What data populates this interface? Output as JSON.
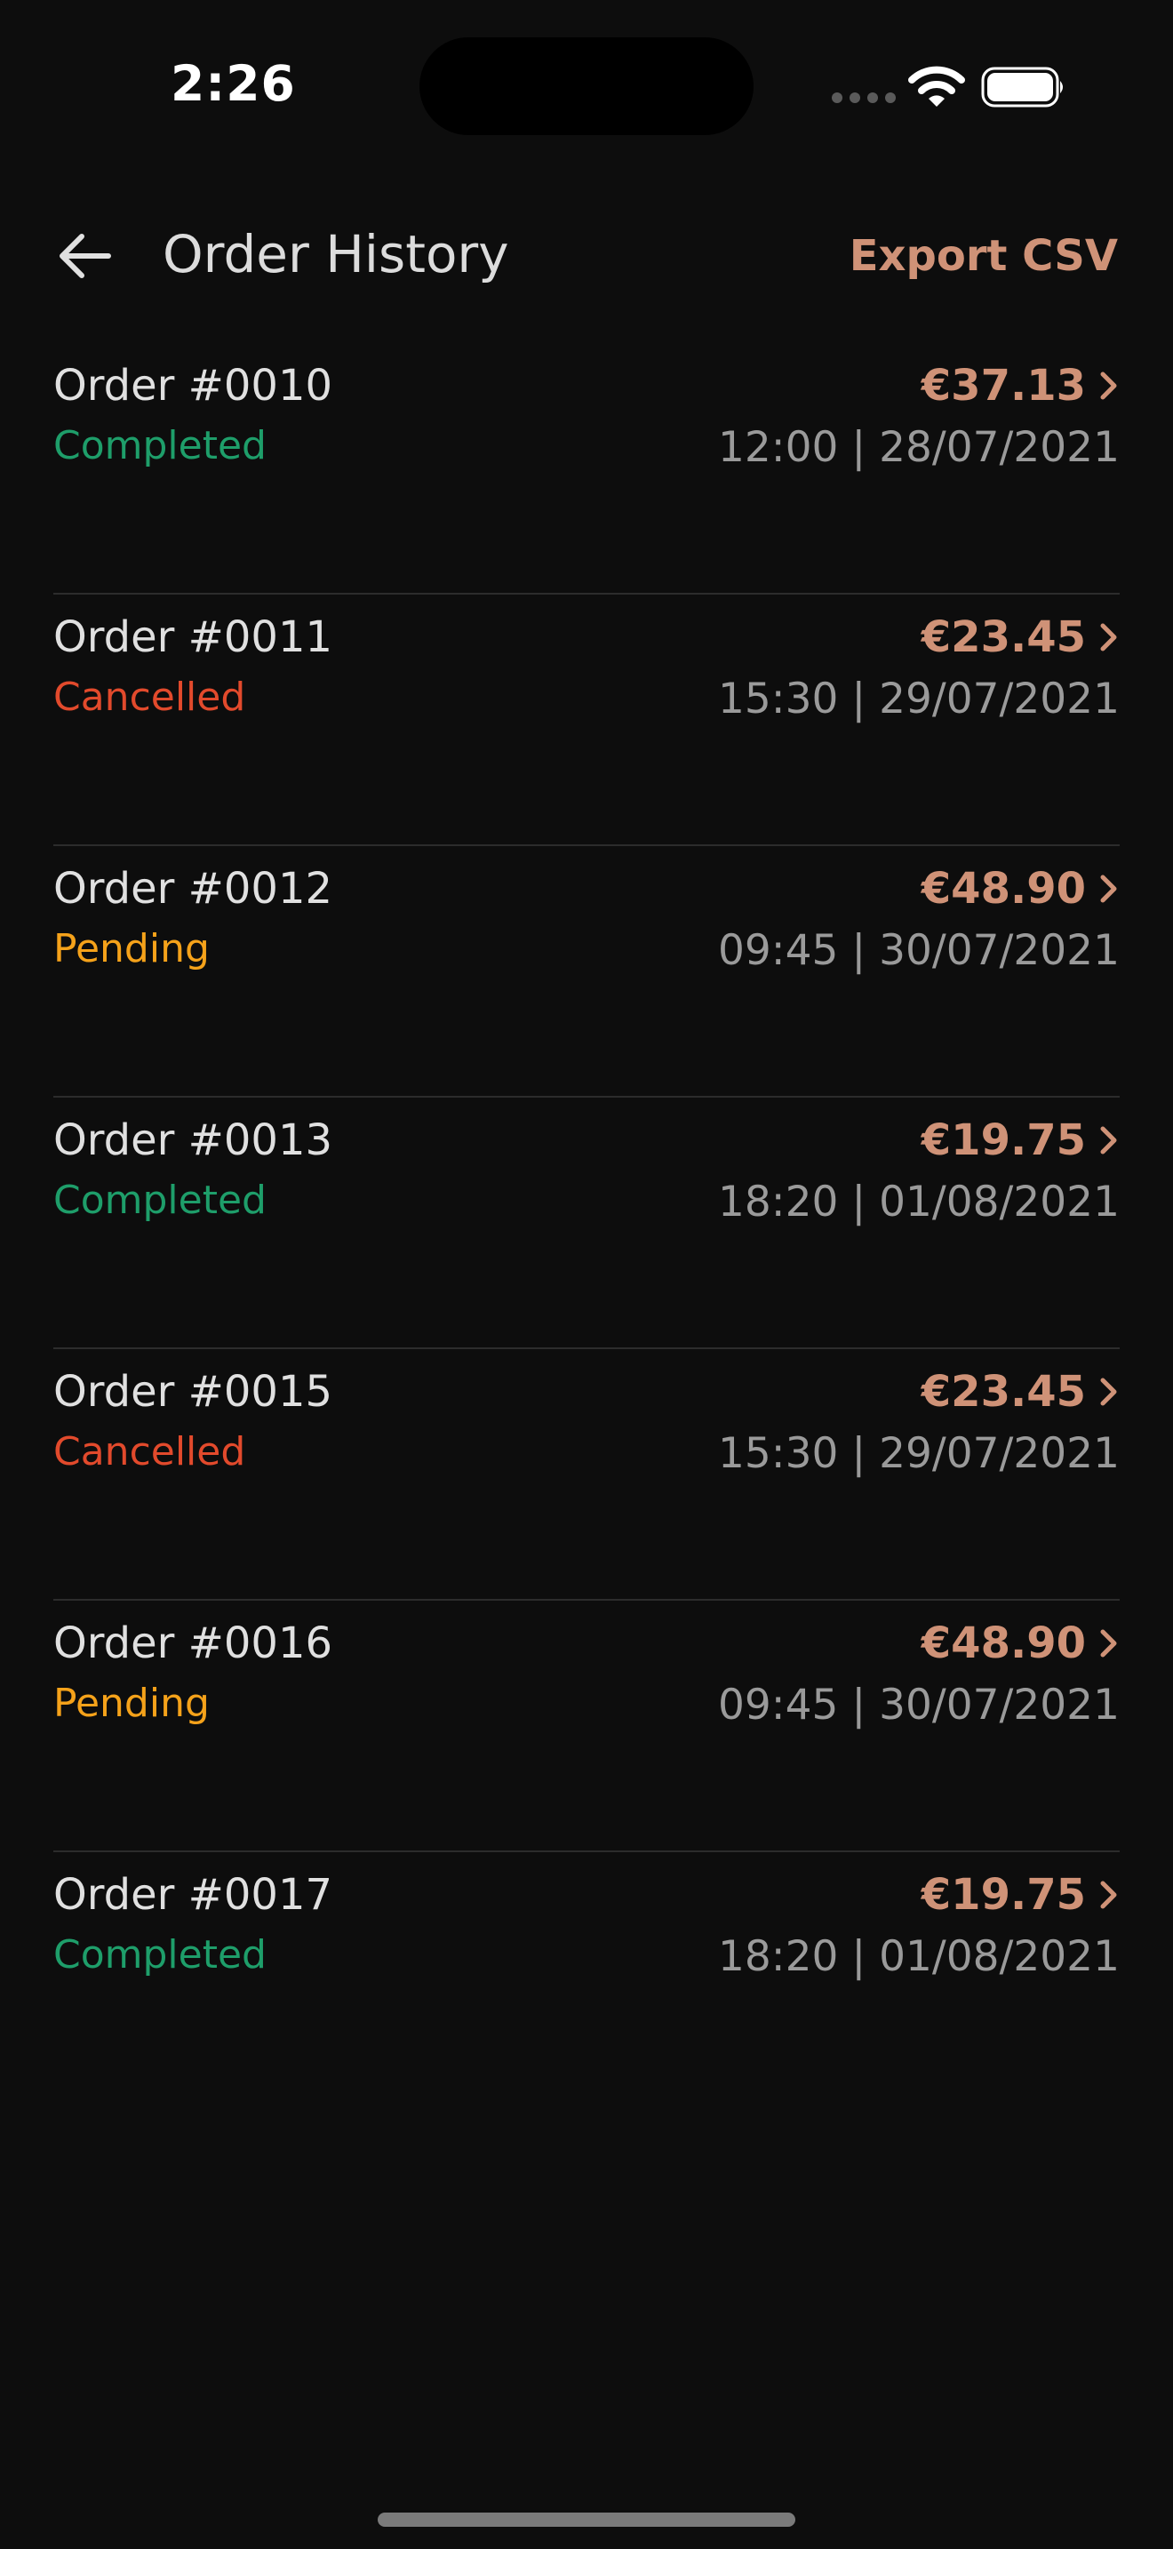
{
  "status_bar": {
    "time": "2:26"
  },
  "header": {
    "back_icon": "arrow-left-icon",
    "title": "Order History",
    "export_label": "Export CSV"
  },
  "colors": {
    "background": "#0d0d0d",
    "accent": "#cf9277",
    "completed": "#1e9e6a",
    "cancelled": "#e24a2c",
    "pending": "#f5a21a",
    "secondary_text": "#9a9a9a",
    "divider": "#2c2c2c"
  },
  "orders": [
    {
      "id": "Order #0010",
      "status": "Completed",
      "status_key": "completed",
      "amount": "€37.13",
      "datetime": "12:00 | 28/07/2021"
    },
    {
      "id": "Order #0011",
      "status": "Cancelled",
      "status_key": "cancelled",
      "amount": "€23.45",
      "datetime": "15:30 | 29/07/2021"
    },
    {
      "id": "Order #0012",
      "status": "Pending",
      "status_key": "pending",
      "amount": "€48.90",
      "datetime": "09:45 | 30/07/2021"
    },
    {
      "id": "Order #0013",
      "status": "Completed",
      "status_key": "completed",
      "amount": "€19.75",
      "datetime": "18:20 | 01/08/2021"
    },
    {
      "id": "Order #0015",
      "status": "Cancelled",
      "status_key": "cancelled",
      "amount": "€23.45",
      "datetime": "15:30 | 29/07/2021"
    },
    {
      "id": "Order #0016",
      "status": "Pending",
      "status_key": "pending",
      "amount": "€48.90",
      "datetime": "09:45 | 30/07/2021"
    },
    {
      "id": "Order #0017",
      "status": "Completed",
      "status_key": "completed",
      "amount": "€19.75",
      "datetime": "18:20 | 01/08/2021"
    }
  ]
}
